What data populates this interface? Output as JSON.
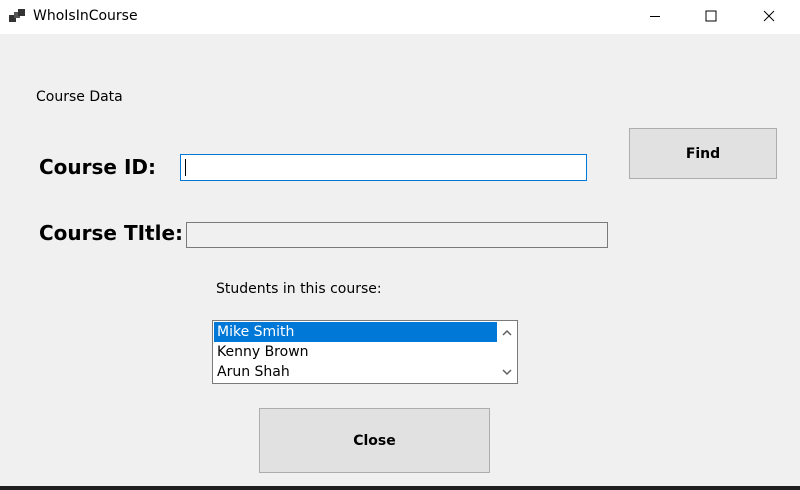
{
  "window": {
    "title": "WhoIsInCourse"
  },
  "form": {
    "section_label": "Course Data",
    "course_id_label": "Course ID:",
    "course_id_value": "",
    "course_title_label": "Course TItle:",
    "course_title_value": "",
    "students_label": "Students in this course:",
    "students": [
      {
        "name": "Mike Smith",
        "selected": true
      },
      {
        "name": "Kenny Brown",
        "selected": false
      },
      {
        "name": "Arun Shah",
        "selected": false
      }
    ],
    "find_button": "Find",
    "close_button": "Close"
  },
  "colors": {
    "accent": "#0078d7",
    "window_bg": "#f0f0f0",
    "button_bg": "#e1e1e1"
  },
  "icons": {
    "app": "app-window-icon",
    "minimize": "minimize-icon",
    "maximize": "maximize-icon",
    "close": "close-icon",
    "scroll_up": "chevron-up-icon",
    "scroll_down": "chevron-down-icon"
  }
}
